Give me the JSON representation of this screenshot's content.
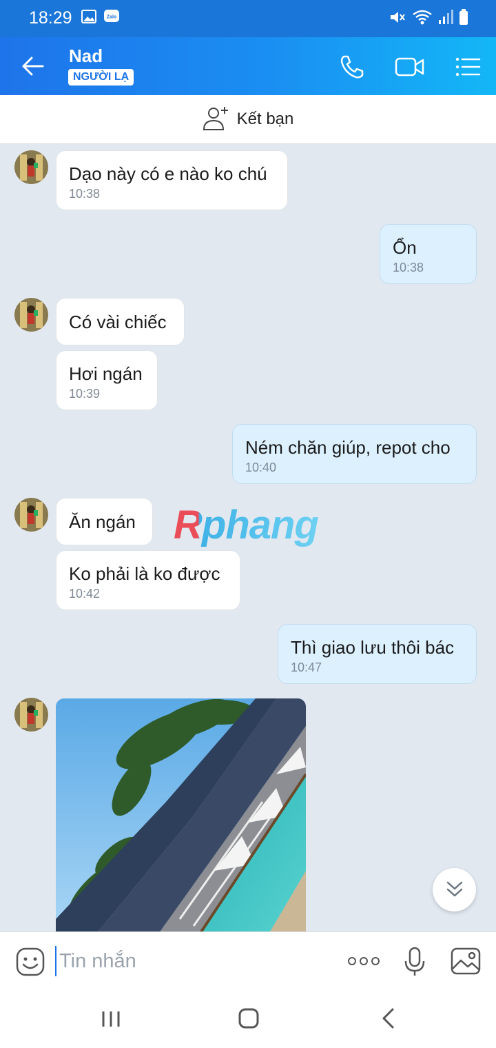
{
  "status_bar": {
    "time": "18:29"
  },
  "header": {
    "contact_name": "Nad",
    "badge": "NGƯỜI LẠ"
  },
  "add_friend": {
    "label": "Kết bạn"
  },
  "messages": [
    {
      "text": "Dạo này có e nào ko chú",
      "time": "10:38"
    },
    {
      "text": "Ổn",
      "time": "10:38"
    },
    {
      "text": "Có vài chiếc"
    },
    {
      "text": "Hơi ngán",
      "time": "10:39"
    },
    {
      "text": "Ném chăn giúp, repot cho",
      "time": "10:40"
    },
    {
      "text": "Ăn ngán"
    },
    {
      "text": "Ko phải là ko được",
      "time": "10:42"
    },
    {
      "text": "Thì giao lưu thôi bác",
      "time": "10:47"
    }
  ],
  "watermark": "Rphang",
  "composer": {
    "placeholder": "Tin nhắn"
  },
  "colors": {
    "accent": "#1a73e8",
    "header_start": "#1e74ea",
    "header_end": "#13b7f7",
    "chat_bg": "#e2e8f0",
    "outgoing_bubble": "#dcf0fe"
  }
}
